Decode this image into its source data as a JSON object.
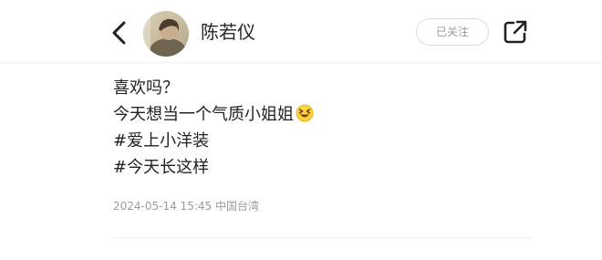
{
  "header": {
    "username": "陈若仪",
    "follow_label": "已关注"
  },
  "post": {
    "lines": [
      "喜欢吗？",
      "今天想当一个气质小姐姐"
    ],
    "emoji": "laughing-squint-emoji",
    "hashtags": [
      "#爱上小洋装",
      "#今天长这样"
    ]
  },
  "meta": {
    "timestamp": "2024-05-14 15:45",
    "location": "中国台湾"
  },
  "icons": {
    "back": "chevron-left-icon",
    "share": "share-icon"
  }
}
